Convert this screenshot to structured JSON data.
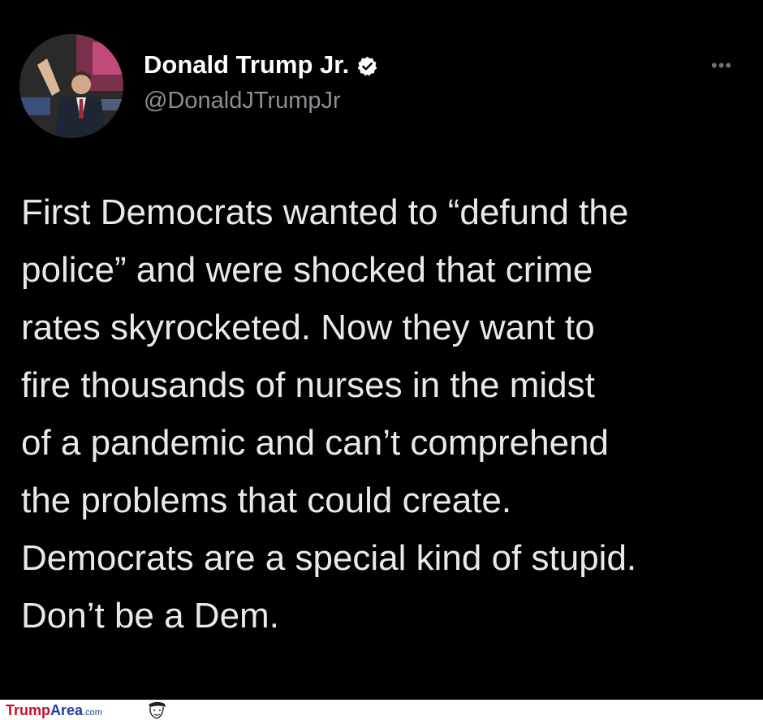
{
  "tweet": {
    "display_name": "Donald Trump Jr.",
    "handle": "@DonaldJTrumpJr",
    "verified_icon": "verified-badge-icon",
    "more_icon": "more-options-icon",
    "more_glyph": "•••",
    "lines": [
      "First Democrats wanted to “defund the",
      "police” and were shocked that crime",
      "rates skyrocketed. Now they want to",
      "fire thousands of nurses in the midst",
      "of a pandemic and can’t comprehend",
      "the problems that could create.",
      "Democrats are a special kind of stupid.",
      "Don’t be a Dem."
    ]
  },
  "watermark": {
    "part1": "Trump",
    "part2": "Area",
    "part3": ".com",
    "color_red": "#c8102e",
    "color_blue": "#1f3f99"
  },
  "colors": {
    "background": "#000000",
    "name": "#ffffff",
    "handle": "#8b8f94",
    "body": "#e7e9ea"
  }
}
